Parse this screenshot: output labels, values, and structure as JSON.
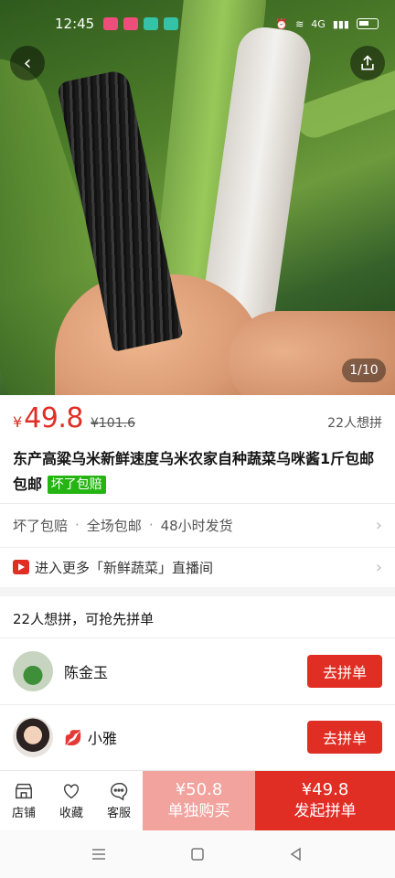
{
  "status_bar": {
    "time": "12:45",
    "network": "4G",
    "app_colors": [
      "#f04e7a",
      "#f04e7a",
      "#36c2a6",
      "#36c2a6"
    ]
  },
  "gallery": {
    "counter": "1/10"
  },
  "product": {
    "currency": "¥",
    "price": "49.8",
    "original_price": "¥101.6",
    "want_count": "22人想拼",
    "title": "东产高粱乌米新鲜速度乌米农家自种蔬菜乌咪酱1斤包邮包邮",
    "title_badge": "坏了包赔"
  },
  "services": {
    "items": [
      "坏了包赔",
      "全场包邮",
      "48小时发货"
    ],
    "separator": "·"
  },
  "live": {
    "text": "进入更多「新鲜蔬菜」直播间"
  },
  "group": {
    "heading": "22人想拼，可抢先拼单",
    "members": [
      {
        "name": "陈金玉",
        "button": "去拼单"
      },
      {
        "name": "小雅",
        "button": "去拼单"
      }
    ]
  },
  "bottom_bar": {
    "shop_label": "店铺",
    "fav_label": "收藏",
    "service_label": "客服",
    "single_price": "¥50.8",
    "single_label": "单独购买",
    "group_price": "¥49.8",
    "group_label": "发起拼单"
  },
  "colors": {
    "accent": "#e02e24",
    "badge_green": "#25b513",
    "single_buy": "#f2a39e"
  }
}
